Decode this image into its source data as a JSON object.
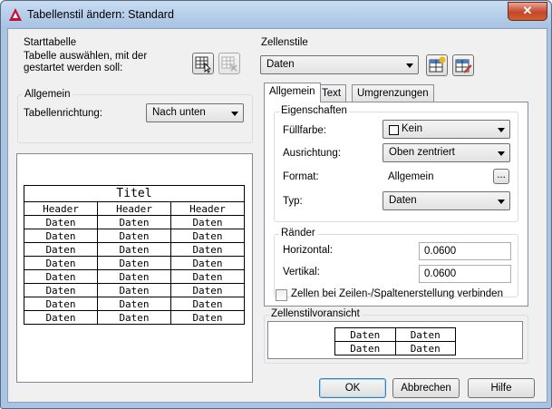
{
  "window": {
    "title": "Tabellenstil ändern: Standard",
    "close_label": "✕"
  },
  "start": {
    "label": "Starttabelle",
    "desc": [
      "Tabelle auswählen, mit der",
      "gestartet werden soll:"
    ]
  },
  "general": {
    "label": "Allgemein",
    "direction_label": "Tabellenrichtung:",
    "direction_value": "Nach unten"
  },
  "preview": {
    "title": "Titel",
    "header": "Header",
    "data": "Daten",
    "columns": 3,
    "data_rows": 8
  },
  "cellstyles": {
    "label": "Zellenstile",
    "value": "Daten"
  },
  "tabs": [
    "Allgemein",
    "Text",
    "Umgrenzungen"
  ],
  "properties": {
    "label": "Eigenschaften",
    "fill_label": "Füllfarbe:",
    "fill_value": "Kein",
    "align_label": "Ausrichtung:",
    "align_value": "Oben zentriert",
    "format_label": "Format:",
    "format_value": "Allgemein",
    "format_button": "...",
    "type_label": "Typ:",
    "type_value": "Daten"
  },
  "margins": {
    "label": "Ränder",
    "horizontal_label": "Horizontal:",
    "horizontal_value": "0.0600",
    "vertical_label": "Vertikal:",
    "vertical_value": "0.0600"
  },
  "merge_label": "Zellen bei Zeilen-/Spaltenerstellung verbinden",
  "cell_preview": {
    "label": "Zellenstilvoransicht",
    "cell": "Daten"
  },
  "buttons": {
    "ok": "OK",
    "cancel": "Abbrechen",
    "help": "Hilfe"
  }
}
